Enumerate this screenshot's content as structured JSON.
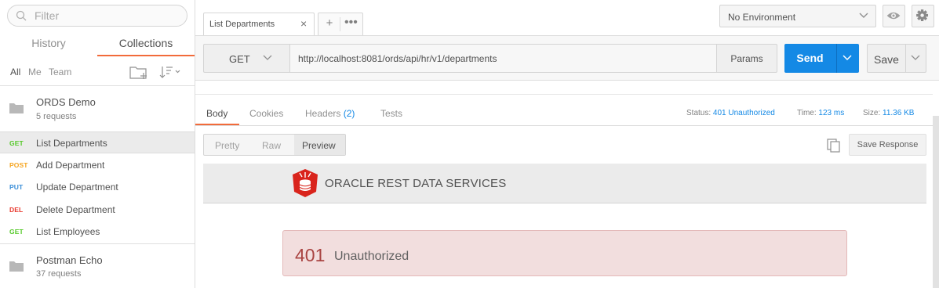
{
  "sidebar": {
    "filter_placeholder": "Filter",
    "tabs": {
      "history": "History",
      "collections": "Collections"
    },
    "filters": {
      "all": "All",
      "me": "Me",
      "team": "Team"
    },
    "collections": [
      {
        "name": "ORDS Demo",
        "count": "5 requests",
        "requests": [
          {
            "method": "GET",
            "label": "List Departments",
            "active": true
          },
          {
            "method": "POST",
            "label": "Add Department"
          },
          {
            "method": "PUT",
            "label": "Update Department"
          },
          {
            "method": "DEL",
            "label": "Delete Department"
          },
          {
            "method": "GET",
            "label": "List Employees"
          }
        ]
      },
      {
        "name": "Postman Echo",
        "count": "37 requests"
      }
    ]
  },
  "topbar": {
    "tab_title": "List Departments",
    "tab_close": "×",
    "new_tab": "+",
    "more": "•••",
    "environment": "No Environment"
  },
  "request": {
    "method": "GET",
    "url": "http://localhost:8081/ords/api/hr/v1/departments",
    "params_label": "Params",
    "send_label": "Send",
    "save_label": "Save"
  },
  "response": {
    "tabs": {
      "body": "Body",
      "cookies": "Cookies",
      "headers": "Headers",
      "headers_count": "(2)",
      "tests": "Tests"
    },
    "status_label": "Status:",
    "status_value": "401 Unauthorized",
    "time_label": "Time:",
    "time_value": "123 ms",
    "size_label": "Size:",
    "size_value": "11.36 KB",
    "view_options": {
      "pretty": "Pretty",
      "raw": "Raw",
      "preview": "Preview"
    },
    "save_response": "Save Response",
    "preview": {
      "banner_title": "ORACLE REST DATA SERVICES",
      "error_code": "401",
      "error_text": "Unauthorized"
    }
  },
  "colors": {
    "accent_orange": "#f26b3a",
    "send_blue": "#1489e5",
    "get": "#56c92a",
    "post": "#f5a623",
    "put": "#3a8ed8",
    "del": "#e8392e",
    "error_bg": "#f2dede",
    "error_code": "#a94442"
  }
}
